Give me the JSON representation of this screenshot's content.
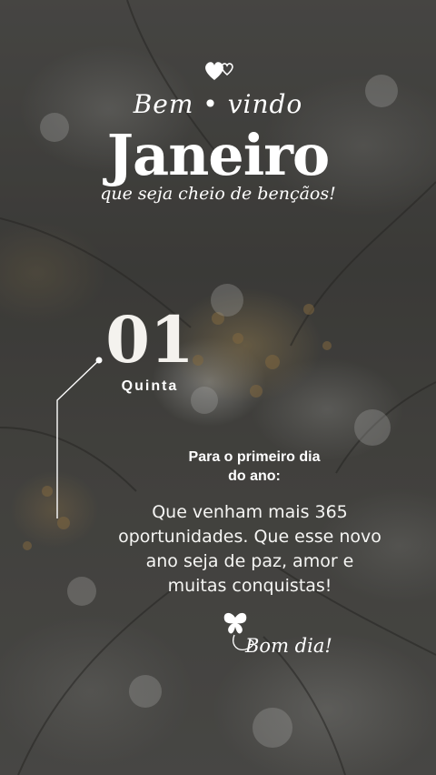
{
  "post": {
    "welcome": "Bem • vindo",
    "month": "Janeiro",
    "subtitle": "que seja cheio de bençãos!",
    "day_number": "01",
    "weekday": "Quinta",
    "intro_line1": "Para o primeiro dia",
    "intro_line2": "do ano:",
    "message_line1": "Que venham mais 365",
    "message_line2": "oportunidades. Que esse novo",
    "message_line3": "ano seja de paz, amor e",
    "message_line4": "muitas conquistas!",
    "closing": "Bom dia!"
  },
  "icons": {
    "top": "hearts-icon",
    "bottom": "butterfly-icon"
  },
  "colors": {
    "text": "#ffffff"
  }
}
